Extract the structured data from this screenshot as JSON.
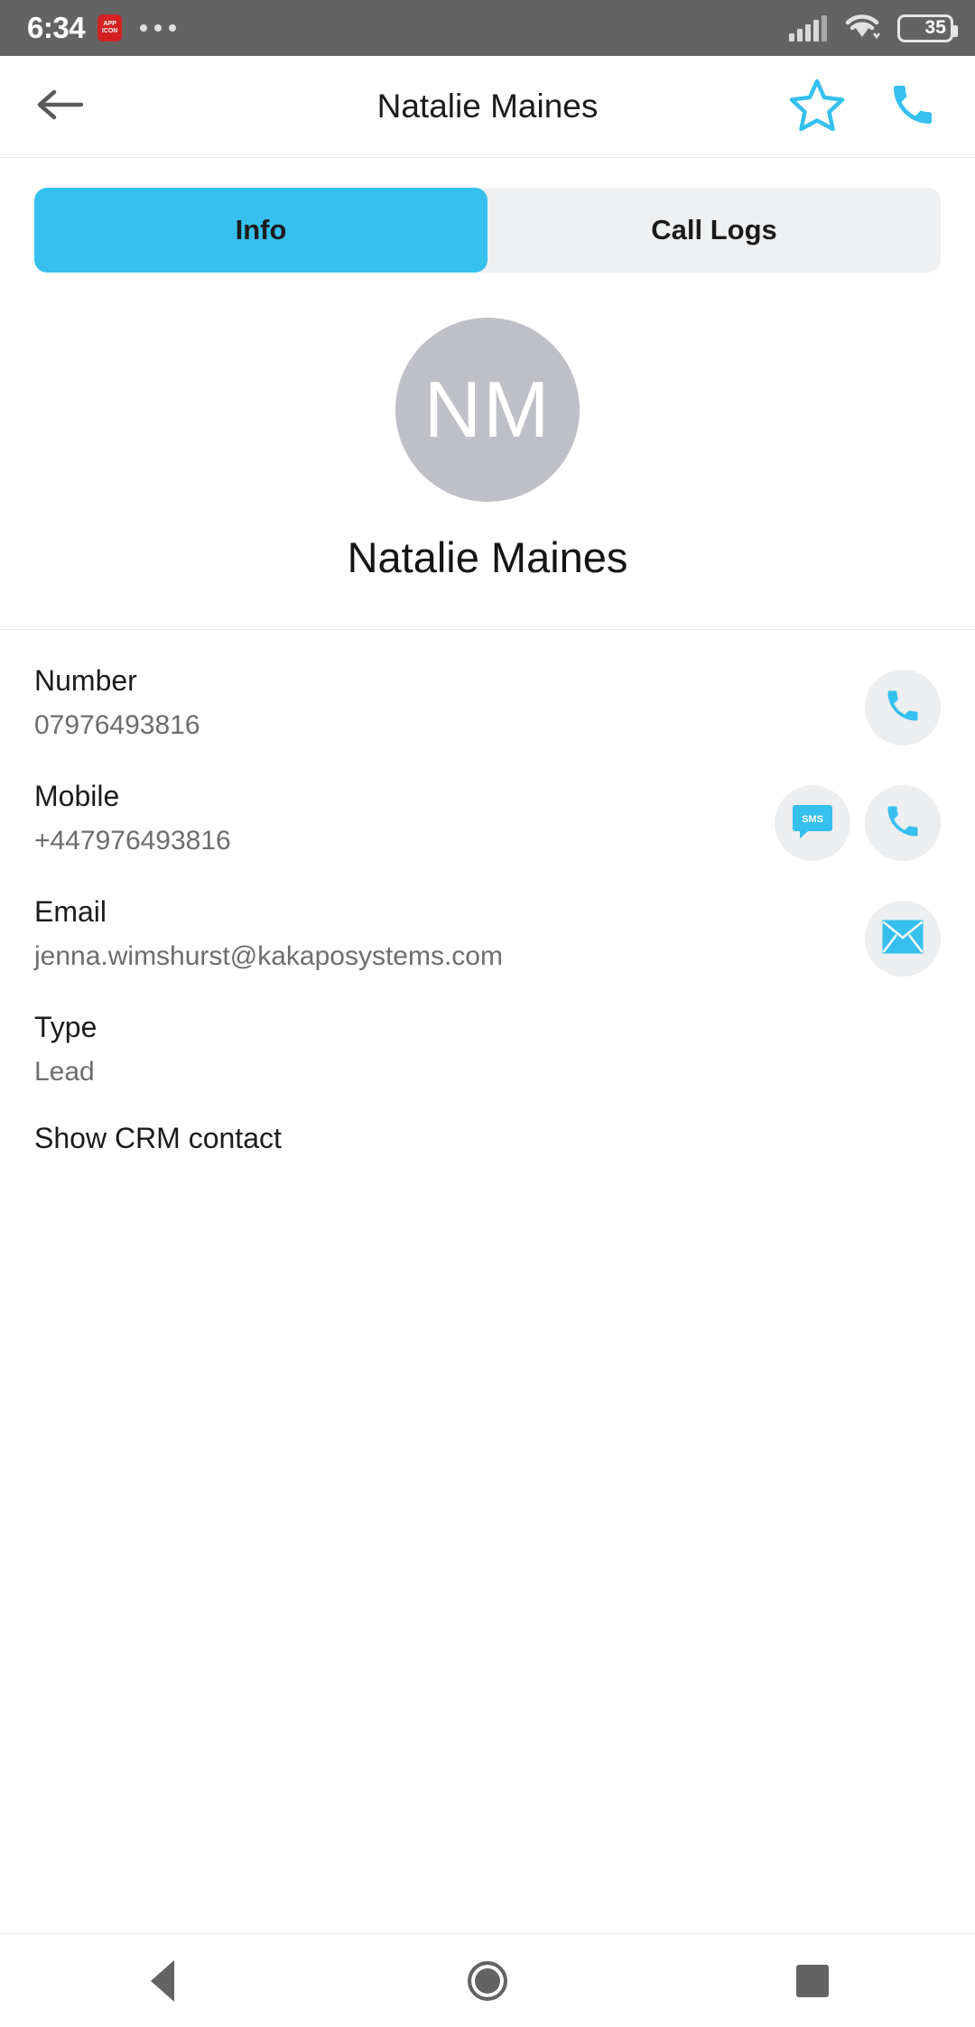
{
  "status_bar": {
    "time": "6:34",
    "app_icon_label": "APP",
    "battery_level": "35",
    "battery_percent": 35,
    "signal_icon": "cellular-signal-icon",
    "wifi_icon": "wifi-icon",
    "overflow_icon": "more-notifications-icon"
  },
  "app_bar": {
    "back_icon": "back-arrow-icon",
    "title": "Natalie Maines",
    "favorite_icon": "star-outline-icon",
    "call_icon": "phone-icon"
  },
  "tabs": [
    {
      "label": "Info",
      "active": true
    },
    {
      "label": "Call Logs",
      "active": false
    }
  ],
  "profile": {
    "initials": "NM",
    "name": "Natalie Maines"
  },
  "details": [
    {
      "label": "Number",
      "value": "07976493816",
      "actions": [
        {
          "icon": "phone-icon",
          "name": "call-number-button"
        }
      ]
    },
    {
      "label": "Mobile",
      "value": "+447976493816",
      "actions": [
        {
          "icon": "sms-icon",
          "name": "sms-mobile-button",
          "text": "SMS"
        },
        {
          "icon": "phone-icon",
          "name": "call-mobile-button"
        }
      ]
    },
    {
      "label": "Email",
      "value": "jenna.wimshurst@kakaposystems.com",
      "actions": [
        {
          "icon": "envelope-icon",
          "name": "send-email-button"
        }
      ]
    },
    {
      "label": "Type",
      "value": "Lead",
      "actions": []
    }
  ],
  "crm_link": "Show CRM contact",
  "nav_bar": {
    "back": "nav-back-icon",
    "home": "nav-home-icon",
    "recents": "nav-recents-icon"
  },
  "colors": {
    "accent": "#35c0ef",
    "status_bar_bg": "#636363",
    "tab_inactive_bg": "#eff0f1",
    "avatar_bg": "#bfc0c5",
    "action_circle_bg": "#eceef0",
    "app_icon_red": "#d32020"
  }
}
